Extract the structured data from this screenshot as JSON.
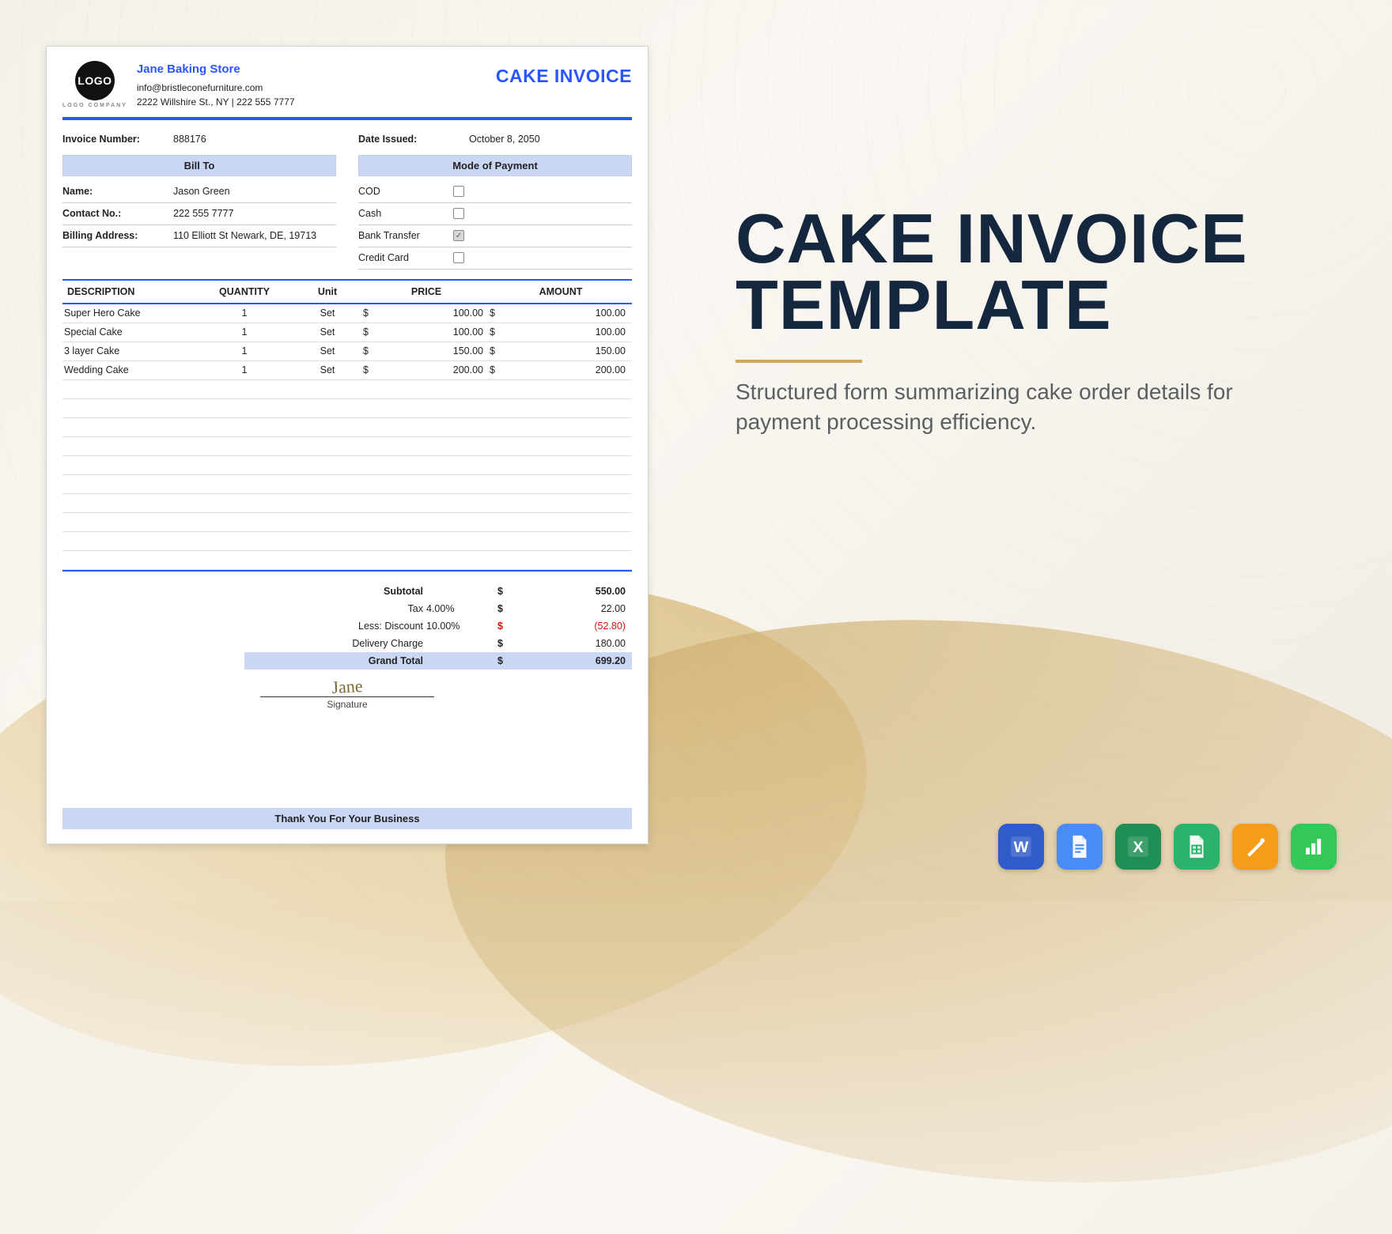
{
  "company": {
    "logo_text": "LOGO",
    "logo_subtext": "LOGO COMPANY",
    "name": "Jane Baking Store",
    "email": "info@bristleconefurniture.com",
    "address_line": "2222 Willshire St., NY | 222 555 7777"
  },
  "doc_title": "CAKE INVOICE",
  "invoice": {
    "number_label": "Invoice Number:",
    "number": "888176",
    "date_label": "Date Issued:",
    "date": "October 8, 2050"
  },
  "bill_to": {
    "heading": "Bill To",
    "name_label": "Name:",
    "name": "Jason Green",
    "contact_label": "Contact No.:",
    "contact": "222 555 7777",
    "addr_label": "Billing Address:",
    "addr": "110 Elliott St Newark, DE, 19713"
  },
  "payment": {
    "heading": "Mode of Payment",
    "methods": [
      {
        "label": "COD",
        "checked": false
      },
      {
        "label": "Cash",
        "checked": false
      },
      {
        "label": "Bank Transfer",
        "checked": true
      },
      {
        "label": "Credit Card",
        "checked": false
      }
    ]
  },
  "table": {
    "headers": {
      "desc": "DESCRIPTION",
      "qty": "QUANTITY",
      "unit": "Unit",
      "price": "PRICE",
      "amount": "AMOUNT"
    },
    "rows": [
      {
        "desc": "Super Hero Cake",
        "qty": "1",
        "unit": "Set",
        "price": "100.00",
        "amount": "100.00"
      },
      {
        "desc": "Special Cake",
        "qty": "1",
        "unit": "Set",
        "price": "100.00",
        "amount": "100.00"
      },
      {
        "desc": "3 layer Cake",
        "qty": "1",
        "unit": "Set",
        "price": "150.00",
        "amount": "150.00"
      },
      {
        "desc": "Wedding Cake",
        "qty": "1",
        "unit": "Set",
        "price": "200.00",
        "amount": "200.00"
      }
    ],
    "currency": "$",
    "empty_rows": 10
  },
  "totals": {
    "subtotal_label": "Subtotal",
    "subtotal": "550.00",
    "tax_label": "Tax",
    "tax_pct": "4.00%",
    "tax": "22.00",
    "discount_label": "Less: Discount",
    "discount_pct": "10.00%",
    "discount": "(52.80)",
    "delivery_label": "Delivery Charge",
    "delivery": "180.00",
    "grand_label": "Grand Total",
    "grand": "699.20"
  },
  "signature": {
    "script": "Jane",
    "label": "Signature"
  },
  "thanks": "Thank You For Your Business",
  "hero": {
    "title_line1": "CAKE INVOICE",
    "title_line2": "TEMPLATE",
    "subtitle": "Structured form summarizing cake order details for payment processing efficiency."
  },
  "formats": [
    "word",
    "gdoc",
    "excel",
    "gsheet",
    "pages",
    "numbers"
  ]
}
